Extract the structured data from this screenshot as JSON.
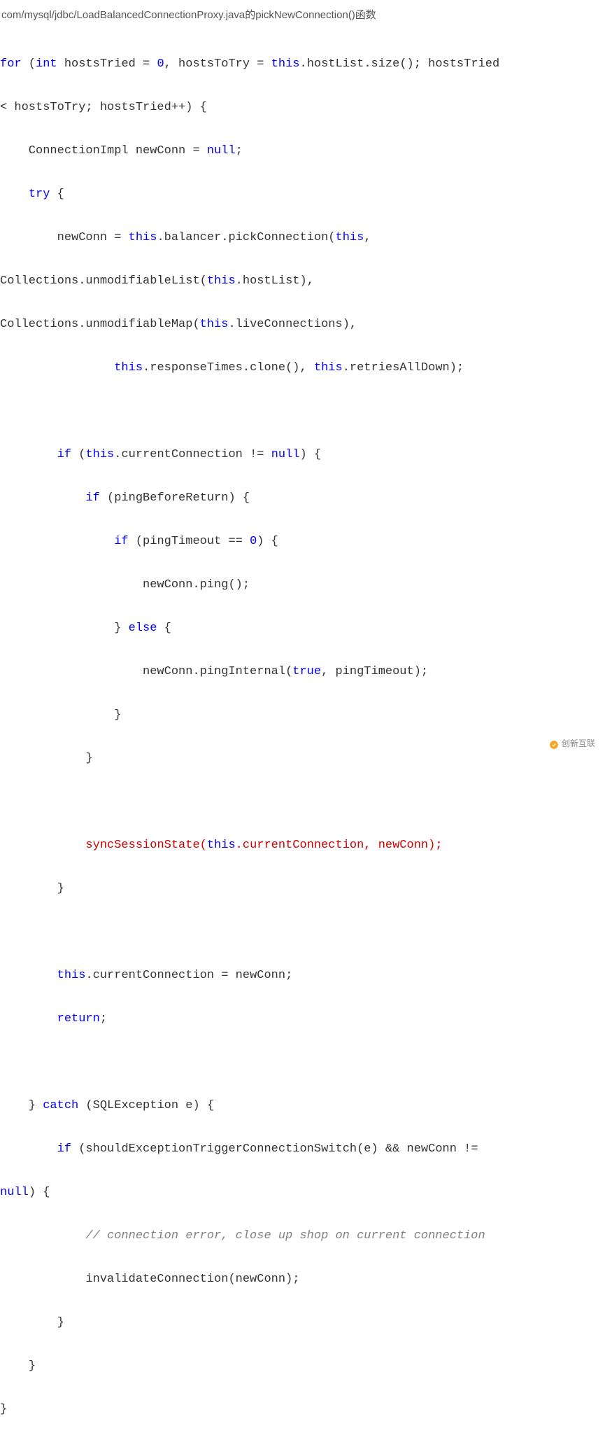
{
  "header": "com/mysql/jdbc/LoadBalancedConnectionProxy.java的pickNewConnection()函数",
  "watermark": "创新互联",
  "code": {
    "l1_a": "for",
    "l1_b": " (",
    "l1_c": "int",
    "l1_d": " hostsTried = ",
    "l1_e": "0",
    "l1_f": ", hostsToTry = ",
    "l1_g": "this",
    "l1_h": ".hostList.size(); hostsTried ",
    "l2_a": "< hostsToTry; hostsTried++) {",
    "l3_a": "    ConnectionImpl newConn = ",
    "l3_b": "null",
    "l3_c": ";",
    "l4_a": "    ",
    "l4_b": "try",
    "l4_c": " {",
    "l5_a": "        newConn = ",
    "l5_b": "this",
    "l5_c": ".balancer.pickConnection(",
    "l5_d": "this",
    "l5_e": ",",
    "l6_a": "Collections.unmodifiableList(",
    "l6_b": "this",
    "l6_c": ".hostList),",
    "l7_a": "Collections.unmodifiableMap(",
    "l7_b": "this",
    "l7_c": ".liveConnections),",
    "l8_a": "                ",
    "l8_b": "this",
    "l8_c": ".responseTimes.clone(), ",
    "l8_d": "this",
    "l8_e": ".retriesAllDown);",
    "l9": "",
    "l10_a": "        ",
    "l10_b": "if",
    "l10_c": " (",
    "l10_d": "this",
    "l10_e": ".currentConnection != ",
    "l10_f": "null",
    "l10_g": ") {",
    "l11_a": "            ",
    "l11_b": "if",
    "l11_c": " (pingBeforeReturn) {",
    "l12_a": "                ",
    "l12_b": "if",
    "l12_c": " (pingTimeout == ",
    "l12_d": "0",
    "l12_e": ") {",
    "l13": "                    newConn.ping();",
    "l14_a": "                } ",
    "l14_b": "else",
    "l14_c": " {",
    "l15_a": "                    newConn.pingInternal(",
    "l15_b": "true",
    "l15_c": ", pingTimeout);",
    "l16": "                }",
    "l17": "            }",
    "l18": "",
    "l19_a": "            ",
    "l19_b": "syncSessionState(",
    "l19_c": "this",
    "l19_d": ".currentConnection, newConn);",
    "l20": "        }",
    "l21": "",
    "l22_a": "        ",
    "l22_b": "this",
    "l22_c": ".currentConnection = newConn;",
    "l23_a": "        ",
    "l23_b": "return",
    "l23_c": ";",
    "l24": "",
    "l25_a": "    } ",
    "l25_b": "catch",
    "l25_c": " (SQLException e) {",
    "l26_a": "        ",
    "l26_b": "if",
    "l26_c": " (shouldExceptionTriggerConnectionSwitch(e) && newConn != ",
    "l27_a": "null",
    "l27_b": ") {",
    "l28_a": "            ",
    "l28_b": "// connection error, close up shop on current connection",
    "l29": "            invalidateConnection(newConn);",
    "l30": "        }",
    "l31": "    }",
    "l32": "}"
  }
}
